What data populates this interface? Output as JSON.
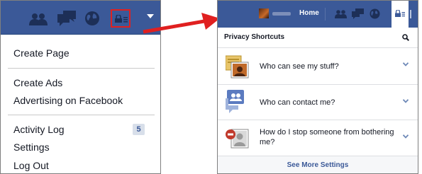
{
  "colors": {
    "brand_blue": "#3b5998",
    "highlight_red": "#e02020",
    "link_blue": "#3b5998",
    "badge_bg": "#d8dfea"
  },
  "old_menu": {
    "topbar_icons": [
      "friends-icon",
      "messages-icon",
      "globe-icon",
      "lock-icon",
      "caret-down-icon"
    ],
    "groups": [
      {
        "items": [
          "Create Page"
        ]
      },
      {
        "items": [
          "Create Ads",
          "Advertising on Facebook"
        ]
      },
      {
        "items": [
          "Activity Log",
          "Settings",
          "Log Out"
        ]
      }
    ],
    "activity_log_count": "5"
  },
  "new_menu": {
    "topbar": {
      "home_label": "Home",
      "icons": [
        "avatar",
        "friends-icon",
        "messages-icon",
        "globe-icon",
        "lock-icon"
      ]
    },
    "title": "Privacy Shortcuts",
    "rows": [
      {
        "label": "Who can see my stuff?",
        "icon": "privacy-photo-icon"
      },
      {
        "label": "Who can contact me?",
        "icon": "contact-people-icon"
      },
      {
        "label": "How do I stop someone from bothering me?",
        "icon": "block-user-icon"
      }
    ],
    "footer_link": "See More Settings"
  }
}
